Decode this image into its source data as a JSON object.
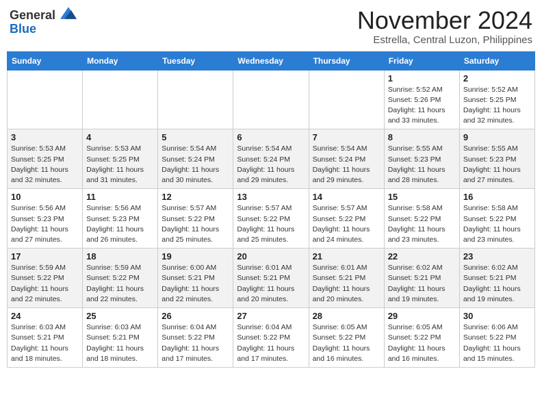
{
  "header": {
    "logo_general": "General",
    "logo_blue": "Blue",
    "month_title": "November 2024",
    "location": "Estrella, Central Luzon, Philippines"
  },
  "days_of_week": [
    "Sunday",
    "Monday",
    "Tuesday",
    "Wednesday",
    "Thursday",
    "Friday",
    "Saturday"
  ],
  "weeks": [
    [
      {
        "day": "",
        "info": ""
      },
      {
        "day": "",
        "info": ""
      },
      {
        "day": "",
        "info": ""
      },
      {
        "day": "",
        "info": ""
      },
      {
        "day": "",
        "info": ""
      },
      {
        "day": "1",
        "info": "Sunrise: 5:52 AM\nSunset: 5:26 PM\nDaylight: 11 hours and 33 minutes."
      },
      {
        "day": "2",
        "info": "Sunrise: 5:52 AM\nSunset: 5:25 PM\nDaylight: 11 hours and 32 minutes."
      }
    ],
    [
      {
        "day": "3",
        "info": "Sunrise: 5:53 AM\nSunset: 5:25 PM\nDaylight: 11 hours and 32 minutes."
      },
      {
        "day": "4",
        "info": "Sunrise: 5:53 AM\nSunset: 5:25 PM\nDaylight: 11 hours and 31 minutes."
      },
      {
        "day": "5",
        "info": "Sunrise: 5:54 AM\nSunset: 5:24 PM\nDaylight: 11 hours and 30 minutes."
      },
      {
        "day": "6",
        "info": "Sunrise: 5:54 AM\nSunset: 5:24 PM\nDaylight: 11 hours and 29 minutes."
      },
      {
        "day": "7",
        "info": "Sunrise: 5:54 AM\nSunset: 5:24 PM\nDaylight: 11 hours and 29 minutes."
      },
      {
        "day": "8",
        "info": "Sunrise: 5:55 AM\nSunset: 5:23 PM\nDaylight: 11 hours and 28 minutes."
      },
      {
        "day": "9",
        "info": "Sunrise: 5:55 AM\nSunset: 5:23 PM\nDaylight: 11 hours and 27 minutes."
      }
    ],
    [
      {
        "day": "10",
        "info": "Sunrise: 5:56 AM\nSunset: 5:23 PM\nDaylight: 11 hours and 27 minutes."
      },
      {
        "day": "11",
        "info": "Sunrise: 5:56 AM\nSunset: 5:23 PM\nDaylight: 11 hours and 26 minutes."
      },
      {
        "day": "12",
        "info": "Sunrise: 5:57 AM\nSunset: 5:22 PM\nDaylight: 11 hours and 25 minutes."
      },
      {
        "day": "13",
        "info": "Sunrise: 5:57 AM\nSunset: 5:22 PM\nDaylight: 11 hours and 25 minutes."
      },
      {
        "day": "14",
        "info": "Sunrise: 5:57 AM\nSunset: 5:22 PM\nDaylight: 11 hours and 24 minutes."
      },
      {
        "day": "15",
        "info": "Sunrise: 5:58 AM\nSunset: 5:22 PM\nDaylight: 11 hours and 23 minutes."
      },
      {
        "day": "16",
        "info": "Sunrise: 5:58 AM\nSunset: 5:22 PM\nDaylight: 11 hours and 23 minutes."
      }
    ],
    [
      {
        "day": "17",
        "info": "Sunrise: 5:59 AM\nSunset: 5:22 PM\nDaylight: 11 hours and 22 minutes."
      },
      {
        "day": "18",
        "info": "Sunrise: 5:59 AM\nSunset: 5:22 PM\nDaylight: 11 hours and 22 minutes."
      },
      {
        "day": "19",
        "info": "Sunrise: 6:00 AM\nSunset: 5:21 PM\nDaylight: 11 hours and 22 minutes."
      },
      {
        "day": "20",
        "info": "Sunrise: 6:01 AM\nSunset: 5:21 PM\nDaylight: 11 hours and 20 minutes."
      },
      {
        "day": "21",
        "info": "Sunrise: 6:01 AM\nSunset: 5:21 PM\nDaylight: 11 hours and 20 minutes."
      },
      {
        "day": "22",
        "info": "Sunrise: 6:02 AM\nSunset: 5:21 PM\nDaylight: 11 hours and 19 minutes."
      },
      {
        "day": "23",
        "info": "Sunrise: 6:02 AM\nSunset: 5:21 PM\nDaylight: 11 hours and 19 minutes."
      }
    ],
    [
      {
        "day": "24",
        "info": "Sunrise: 6:03 AM\nSunset: 5:21 PM\nDaylight: 11 hours and 18 minutes."
      },
      {
        "day": "25",
        "info": "Sunrise: 6:03 AM\nSunset: 5:21 PM\nDaylight: 11 hours and 18 minutes."
      },
      {
        "day": "26",
        "info": "Sunrise: 6:04 AM\nSunset: 5:22 PM\nDaylight: 11 hours and 17 minutes."
      },
      {
        "day": "27",
        "info": "Sunrise: 6:04 AM\nSunset: 5:22 PM\nDaylight: 11 hours and 17 minutes."
      },
      {
        "day": "28",
        "info": "Sunrise: 6:05 AM\nSunset: 5:22 PM\nDaylight: 11 hours and 16 minutes."
      },
      {
        "day": "29",
        "info": "Sunrise: 6:05 AM\nSunset: 5:22 PM\nDaylight: 11 hours and 16 minutes."
      },
      {
        "day": "30",
        "info": "Sunrise: 6:06 AM\nSunset: 5:22 PM\nDaylight: 11 hours and 15 minutes."
      }
    ]
  ]
}
